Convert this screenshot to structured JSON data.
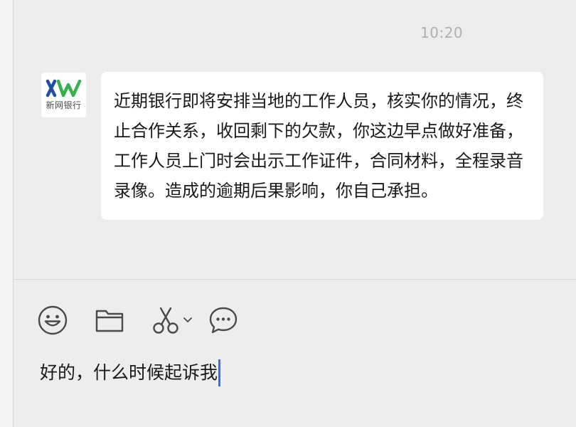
{
  "chat": {
    "timestamp": "10:20",
    "contact": {
      "avatar_logo_letters": "XW",
      "avatar_name": "新网银行",
      "avatar_colors": {
        "x": "#1f4fa8",
        "w": "#35b04a"
      }
    },
    "message_text": "近期银行即将安排当地的工作人员，核实你的情况，终止合作关系，收回剩下的欠款，你这边早点做好准备，工作人员上门时会出示工作证件，合同材料，全程录音录像。造成的逾期后果影响，你自己承担。"
  },
  "toolbar": {
    "icons": [
      "emoji-icon",
      "folder-icon",
      "scissors-icon",
      "chevron-down-icon",
      "chat-bubble-icon"
    ]
  },
  "composer": {
    "text": "好的，什么时候起诉我",
    "caret_color": "#3b6fe0"
  }
}
